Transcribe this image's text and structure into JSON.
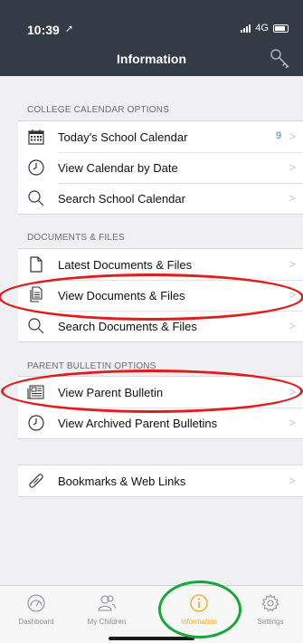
{
  "status": {
    "time": "10:39",
    "network": "4G"
  },
  "header": {
    "title": "Information"
  },
  "sections": [
    {
      "label": "COLLEGE CALENDAR OPTIONS",
      "items": [
        {
          "label": "Today's School Calendar",
          "icon": "calendar-grid-icon",
          "badge": "9"
        },
        {
          "label": "View Calendar by Date",
          "icon": "clock-icon"
        },
        {
          "label": "Search School Calendar",
          "icon": "search-icon"
        }
      ]
    },
    {
      "label": "DOCUMENTS & FILES",
      "items": [
        {
          "label": "Latest Documents & Files",
          "icon": "document-icon"
        },
        {
          "label": "View Documents & Files",
          "icon": "documents-stack-icon"
        },
        {
          "label": "Search Documents & Files",
          "icon": "search-icon"
        }
      ]
    },
    {
      "label": "PARENT BULLETIN OPTIONS",
      "items": [
        {
          "label": "View Parent Bulletin",
          "icon": "newspaper-icon"
        },
        {
          "label": "View Archived Parent Bulletins",
          "icon": "clock-icon"
        }
      ]
    },
    {
      "label": "",
      "items": [
        {
          "label": "Bookmarks & Web Links",
          "icon": "link-icon"
        }
      ]
    }
  ],
  "tabs": [
    {
      "label": "Dashboard",
      "icon": "gauge-icon",
      "active": false
    },
    {
      "label": "My Children",
      "icon": "people-icon",
      "active": false
    },
    {
      "label": "Information",
      "icon": "info-icon",
      "active": true
    },
    {
      "label": "Settings",
      "icon": "gear-icon",
      "active": false
    }
  ],
  "colors": {
    "header_bg": "#333b47",
    "accent": "#f0a818",
    "badge": "#2a8af6",
    "annotation_red": "#e31b1b",
    "annotation_green": "#17a83a"
  }
}
